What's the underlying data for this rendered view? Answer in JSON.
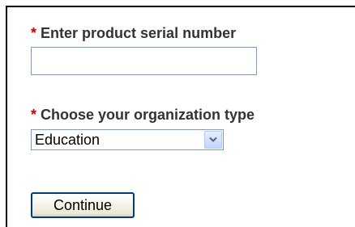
{
  "form": {
    "serial": {
      "required_marker": "*",
      "label": "Enter product serial number",
      "value": "",
      "placeholder": ""
    },
    "org_type": {
      "required_marker": "*",
      "label": "Choose your organization type",
      "selected_value": "Education"
    },
    "continue_label": "Continue"
  },
  "icons": {
    "dropdown_arrow": "chevron-down-icon"
  },
  "colors": {
    "required_marker": "#cc0000",
    "label_text": "#333333",
    "input_border": "#7f9db9",
    "button_border": "#003c74"
  }
}
